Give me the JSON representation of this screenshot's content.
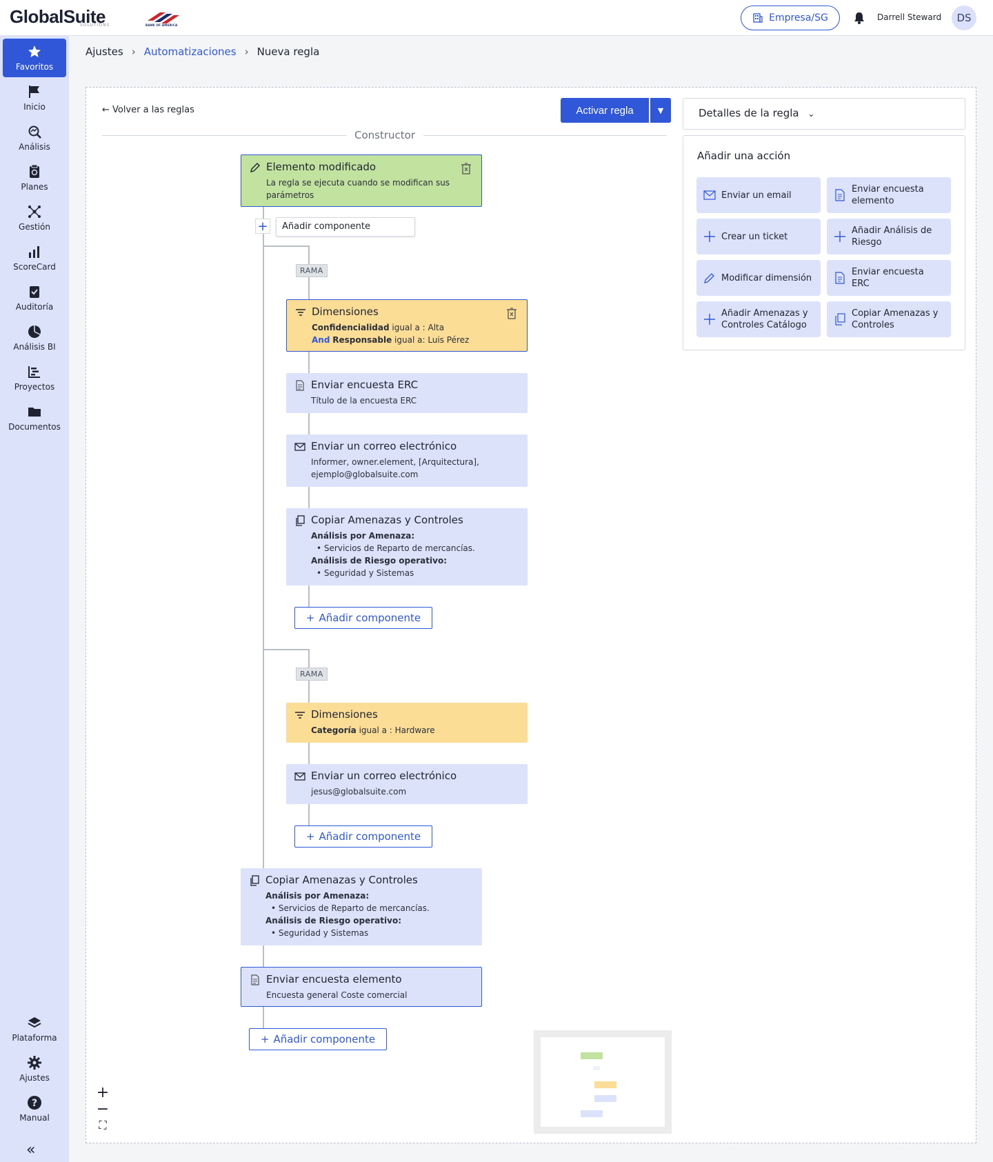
{
  "brand": {
    "name": "GlobalSuite",
    "sub": "SOLUTIONS",
    "partner": "BANK OF AMERICA"
  },
  "header": {
    "company": "Empresa/SG",
    "user": "Darrell Steward",
    "initials": "DS"
  },
  "sidebar": {
    "items": [
      {
        "label": "Favoritos",
        "icon": "star-icon"
      },
      {
        "label": "Inicio",
        "icon": "flag-icon"
      },
      {
        "label": "Análisis",
        "icon": "analysis-icon"
      },
      {
        "label": "Planes",
        "icon": "plans-icon"
      },
      {
        "label": "Gestión",
        "icon": "network-icon"
      },
      {
        "label": "ScoreCard",
        "icon": "bar-chart-icon"
      },
      {
        "label": "Auditoría",
        "icon": "clipboard-check-icon"
      },
      {
        "label": "Análisis BI",
        "icon": "pie-chart-icon"
      },
      {
        "label": "Proyectos",
        "icon": "gantt-icon"
      },
      {
        "label": "Documentos",
        "icon": "folder-icon"
      }
    ],
    "bottom": [
      {
        "label": "Plataforma",
        "icon": "layers-icon"
      },
      {
        "label": "Ajustes",
        "icon": "gear-icon"
      },
      {
        "label": "Manual",
        "icon": "help-icon"
      }
    ]
  },
  "breadcrumb": {
    "root": "Ajustes",
    "section": "Automatizaciones",
    "current": "Nueva regla"
  },
  "builder": {
    "back": "Volver a las reglas",
    "activate": "Activar regla",
    "section_label": "Constructor",
    "add_component": "Añadir componente",
    "branch_label": "RAMA",
    "trigger": {
      "title": "Elemento modificado",
      "desc": "La regla se ejecuta cuando se modifican sus parámetros"
    },
    "branch1": {
      "condition": {
        "title": "Dimensiones",
        "k1": "Confidencialidad",
        "op1": " igual a : Alta",
        "and": "And",
        "k2": "Responsable",
        "op2": " igual a: Luis Pérez"
      },
      "erc": {
        "title": "Enviar encuesta ERC",
        "desc": "Título de la encuesta ERC"
      },
      "email": {
        "title": "Enviar un correo electrónico",
        "desc1": "Informer, owner.element, [Arquitectura],",
        "desc2": "ejemplo@globalsuite.com"
      },
      "copy": {
        "title": "Copiar Amenazas y Controles",
        "h1": "Análisis por Amenaza:",
        "i1": "Servicios de Reparto de mercancías.",
        "h2": "Análisis de Riesgo operativo:",
        "i2": "Seguridad y Sistemas"
      }
    },
    "branch2": {
      "condition": {
        "title": "Dimensiones",
        "k1": "Categoría",
        "op1": " igual a : Hardware"
      },
      "email": {
        "title": "Enviar un correo electrónico",
        "desc": "jesus@globalsuite.com"
      }
    },
    "main_copy": {
      "title": "Copiar Amenazas y Controles",
      "h1": "Análisis por Amenaza:",
      "i1": "Servicios de Reparto de mercancías.",
      "h2": "Análisis de Riesgo operativo:",
      "i2": "Seguridad y Sistemas"
    },
    "survey": {
      "title": "Enviar encuesta elemento",
      "desc": "Encuesta general Coste comercial"
    }
  },
  "details": {
    "title": "Detalles de la regla"
  },
  "actions": {
    "title": "Añadir una acción",
    "items": [
      {
        "label": "Enviar un email",
        "icon": "mail-icon"
      },
      {
        "label": "Enviar encuesta elemento",
        "icon": "document-icon"
      },
      {
        "label": "Crear un ticket",
        "icon": "plus-icon"
      },
      {
        "label": "Añadir Análisis de Riesgo",
        "icon": "plus-icon"
      },
      {
        "label": "Modificar dimensión",
        "icon": "pencil-icon"
      },
      {
        "label": "Enviar encuesta ERC",
        "icon": "document-icon"
      },
      {
        "label": "Añadir Amenazas y Controles Catálogo",
        "icon": "plus-icon"
      },
      {
        "label": "Copiar Amenazas y Controles",
        "icon": "copy-icon"
      }
    ]
  },
  "colors": {
    "accent": "#2f57d8",
    "trigger": "#c2e39f",
    "condition": "#fbdd96",
    "action": "#dde2fb"
  }
}
